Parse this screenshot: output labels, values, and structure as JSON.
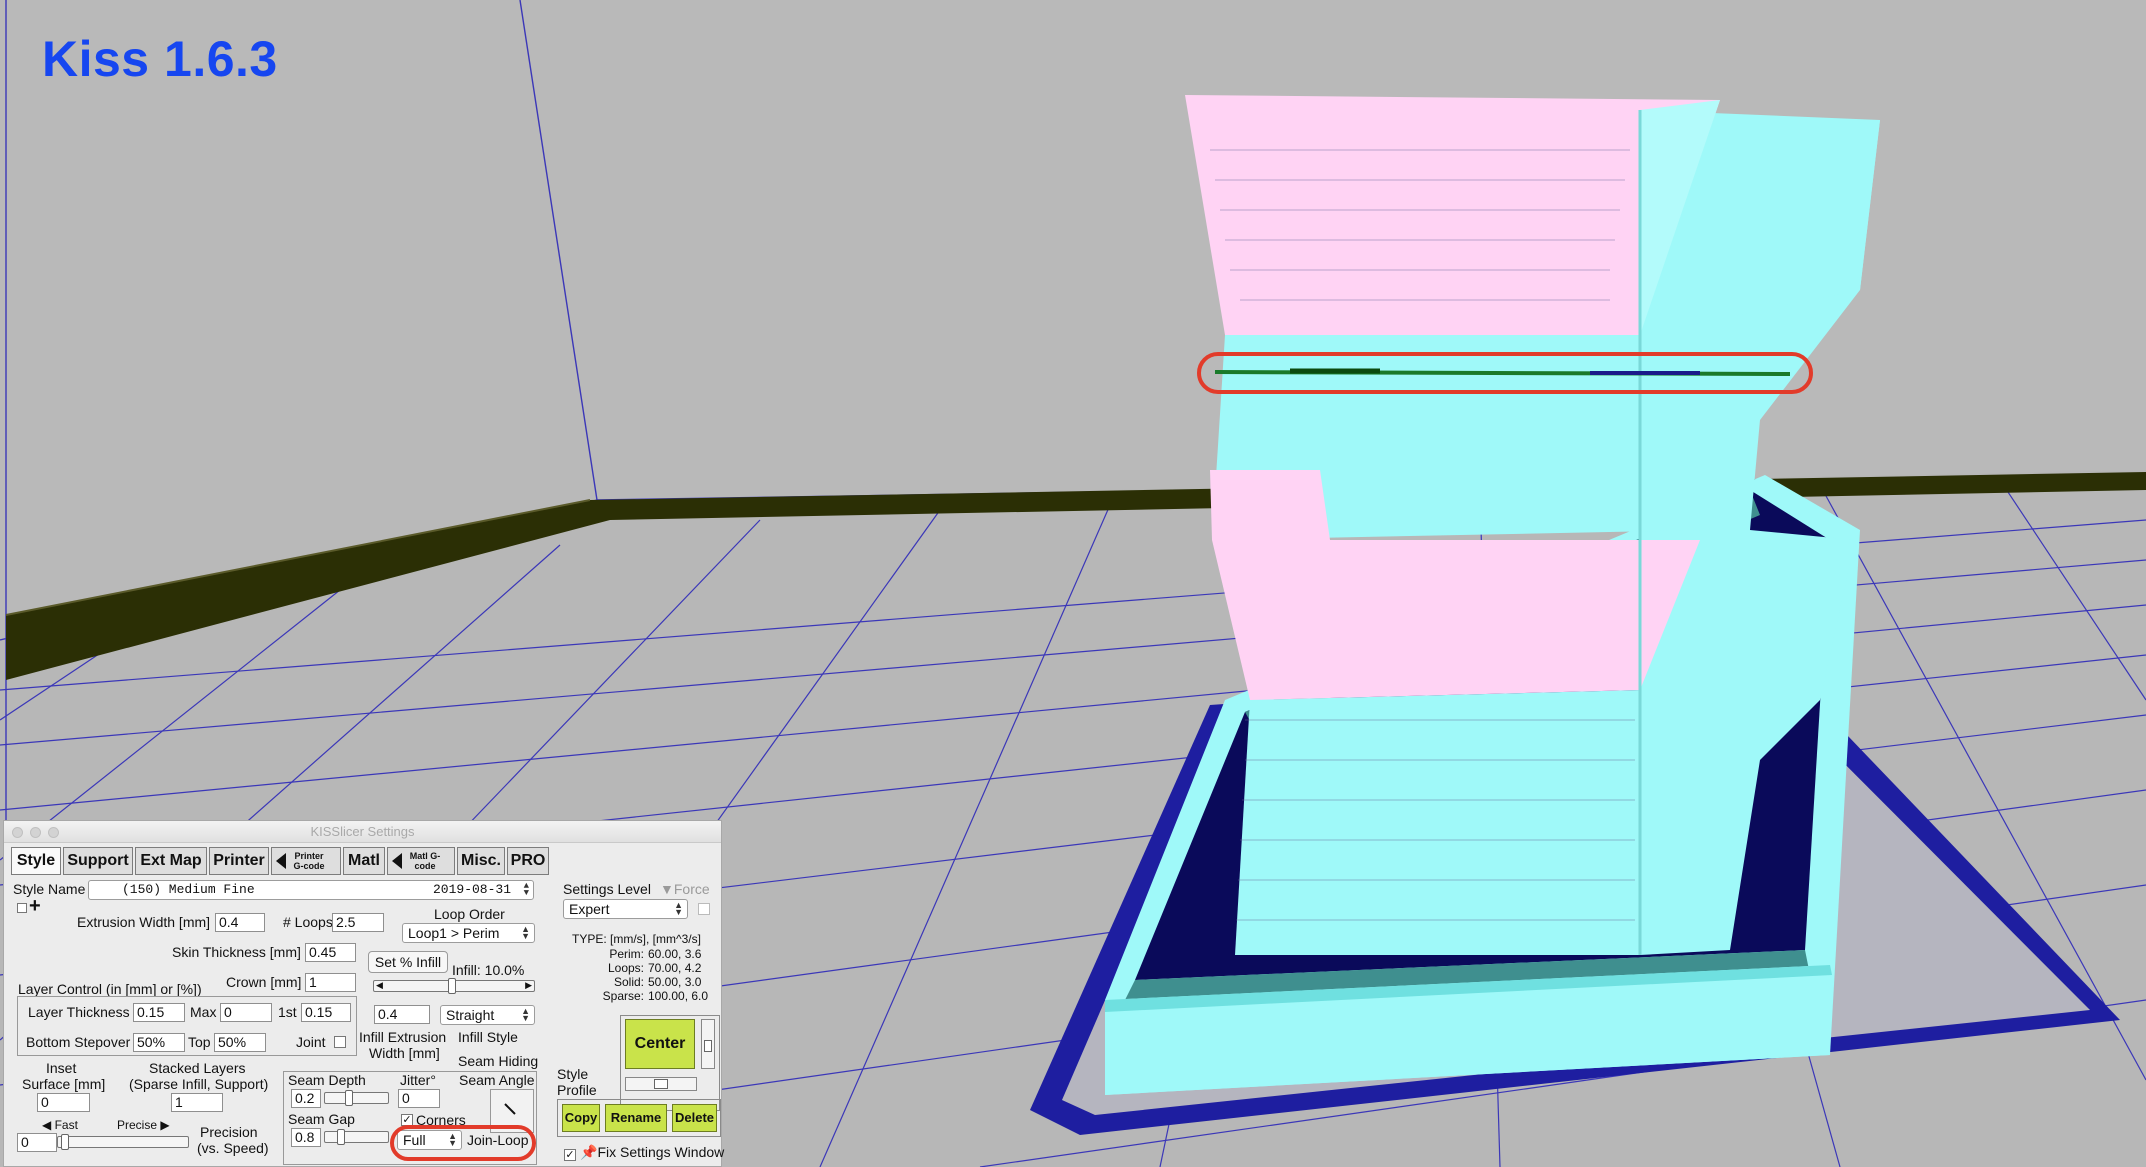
{
  "overlay": {
    "title": "Kiss 1.6.3",
    "title_color": "#1646f0"
  },
  "colors": {
    "background": "#b9b9b9",
    "grid_line": "#3b37b8",
    "bed_edge": "#2b2f05",
    "model_cyan": "#9ff9f9",
    "model_pink": "#ffd3f4",
    "brim_blue": "#1e1ea0",
    "highlight_red": "#e23b2a",
    "button_green": "#c9e34a"
  },
  "settings": {
    "window_title": "KISSlicer Settings",
    "tabs": [
      {
        "label": "Style",
        "selected": true
      },
      {
        "label": "Support"
      },
      {
        "label": "Ext Map"
      },
      {
        "label": "Printer"
      },
      {
        "label": "Printer G-code"
      },
      {
        "label": "Matl"
      },
      {
        "label": "Matl G-code"
      },
      {
        "label": "Misc."
      },
      {
        "label": "PRO"
      }
    ],
    "style_name_label": "Style Name",
    "style_name_value": "(150) Medium Fine",
    "style_name_date": "2019-08-31",
    "extrusion_width_label": "Extrusion Width [mm]",
    "extrusion_width_value": "0.4",
    "loops_label": "# Loops",
    "loops_value": "2.5",
    "loop_order_label": "Loop Order",
    "loop_order_value": "Loop1 > Perim",
    "skin_thickness_label": "Skin Thickness [mm]",
    "skin_thickness_value": "0.45",
    "set_infill_button": "Set % Infill",
    "layer_control_label": "Layer Control (in [mm] or [%])",
    "crown_label": "Crown [mm]",
    "crown_value": "1",
    "infill_label": "Infill: 10.0%",
    "infill_fraction": 0.1,
    "layer_thickness_label": "Layer Thickness",
    "layer_thickness_value": "0.15",
    "max_label": "Max",
    "max_value": "0",
    "first_label": "1st",
    "first_value": "0.15",
    "infill_extrusion_value": "0.4",
    "infill_style_value": "Straight",
    "bottom_stepover_label": "Bottom Stepover",
    "bottom_stepover_value": "50%",
    "top_label": "Top",
    "top_value": "50%",
    "joint_label": "Joint",
    "infill_extrusion_label_1": "Infill Extrusion",
    "infill_extrusion_label_2": "Width [mm]",
    "infill_style_label": "Infill Style",
    "seam_hiding_label": "Seam Hiding",
    "inset_label_1": "Inset",
    "inset_label_2": "Surface [mm]",
    "inset_value": "0",
    "stacked_label_1": "Stacked Layers",
    "stacked_label_2": "(Sparse Infill, Support)",
    "stacked_value": "1",
    "seam_depth_label": "Seam Depth",
    "seam_depth_value": "0.2",
    "jitter_label": "Jitter°",
    "jitter_value": "0",
    "seam_angle_label": "Seam Angle",
    "seam_gap_label": "Seam Gap",
    "seam_gap_value": "0.8",
    "corners_label": "Corners",
    "corners_checked": true,
    "join_mode_value": "Full",
    "join_loop_label": "Join-Loop",
    "fast_label": "Fast",
    "precise_label": "Precise",
    "precision_value": "0",
    "precision_label_1": "Precision",
    "precision_label_2": "(vs. Speed)",
    "settings_level_label": "Settings Level",
    "force_label": "Force",
    "settings_level_value": "Expert",
    "type_header": "TYPE: [mm/s], [mm^3/s]",
    "type_rows": [
      {
        "name": "Perim:",
        "values": "60.00,  3.6"
      },
      {
        "name": "Loops:",
        "values": "70.00,  4.2"
      },
      {
        "name": "Solid:",
        "values": "50.00,  3.0"
      },
      {
        "name": "Sparse:",
        "values": "100.00,  6.0"
      }
    ],
    "center_button": "Center",
    "style_profile_label_1": "Style",
    "style_profile_label_2": "Profile",
    "copy_button": "Copy",
    "rename_button": "Rename",
    "delete_button": "Delete",
    "fix_window_label": "Fix Settings Window",
    "fix_window_checked": true
  }
}
